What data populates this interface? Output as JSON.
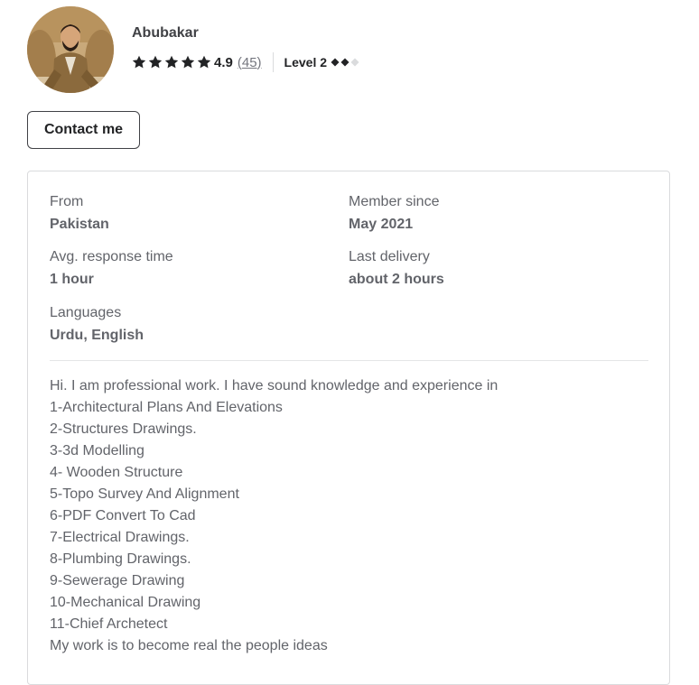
{
  "seller": {
    "name": "Abubakar",
    "rating": "4.9",
    "review_count": "45",
    "level": "Level 2"
  },
  "contact_button": {
    "label": "Contact me"
  },
  "info": {
    "from": {
      "label": "From",
      "value": "Pakistan"
    },
    "member_since": {
      "label": "Member since",
      "value": "May 2021"
    },
    "avg_response": {
      "label": "Avg. response time",
      "value": "1 hour"
    },
    "last_delivery": {
      "label": "Last delivery",
      "value": "about 2 hours"
    },
    "languages": {
      "label": "Languages",
      "value": "Urdu, English"
    }
  },
  "description": {
    "lines": [
      "Hi. I am professional work. I have sound knowledge and experience in",
      "1-Architectural Plans And Elevations",
      "2-Structures Drawings.",
      "3-3d Modelling",
      "4- Wooden Structure",
      "5-Topo Survey And Alignment",
      "6-PDF Convert To Cad",
      "7-Electrical Drawings.",
      "8-Plumbing Drawings.",
      "9-Sewerage Drawing",
      "10-Mechanical Drawing",
      "11-Chief Archetect",
      "My work is to become real the people ideas"
    ]
  },
  "colors": {
    "text_primary": "#404145",
    "text_secondary": "#62646a",
    "star": "#222325",
    "diamond_filled": "#222325",
    "diamond_empty": "#dadbdd",
    "border": "#dadbdd"
  },
  "icons": {
    "star": "star-icon",
    "level_diamond": "diamond-icon"
  }
}
